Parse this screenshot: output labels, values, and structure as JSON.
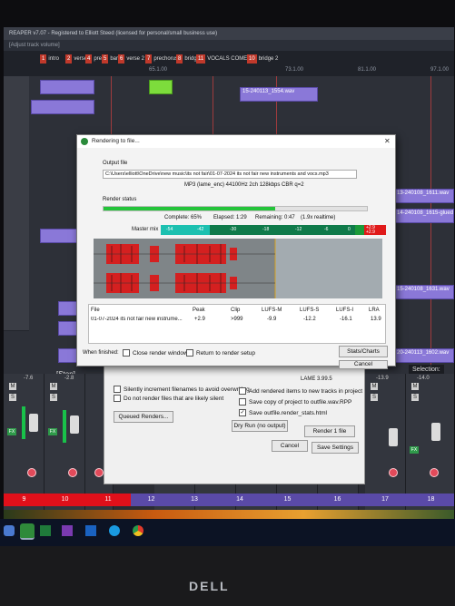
{
  "app": {
    "title_text": "REAPER v7.07 - Registered to Elliott Steed (licensed for personal/small business use)",
    "subtitle": "[Adjust track volume]"
  },
  "markers": [
    {
      "num": "1",
      "label": "intro"
    },
    {
      "num": "2",
      "label": "verse 1"
    },
    {
      "num": "4",
      "label": "pre"
    },
    {
      "num": "5",
      "label": "bar"
    },
    {
      "num": "6",
      "label": "verse 2"
    },
    {
      "num": "7",
      "label": "prechorus"
    },
    {
      "num": "8",
      "label": "bridge"
    },
    {
      "num": "11",
      "label": "VOCALS COME IN"
    },
    {
      "num": "10",
      "label": "bridge 2"
    }
  ],
  "timecodes": [
    "65.1.00",
    "73.1.00",
    "81.1.00",
    "97.1.00"
  ],
  "tracks": {
    "clip_names": [
      "15-240113_1554.wav",
      "13-240108_1611.wav",
      "14-240108_1615-glued",
      "15-240108_1631.wav",
      "20-240113_1602.wav"
    ]
  },
  "render_dialog": {
    "title": "Rendering to file...",
    "output_label": "Output file",
    "output_path": "C:\\Users\\elliott\\OneDrive\\new music\\its not fair\\01-07-2024 its not fair new instruments and vocs.mp3",
    "format_line": "MP3 (lame_enc) 44100Hz 2ch 128kbps CBR q=2",
    "status_label": "Render status",
    "progress_fraction": 0.65,
    "complete_text": "Complete: 65%",
    "elapsed_text": "Elapsed: 1:29",
    "remaining_text": "Remaining: 0:47",
    "speed_text": "(1.9x realtime)",
    "master_mix_label": "Master mix",
    "level_ticks": [
      "-54",
      "-42",
      "-30",
      "-18",
      "-12",
      "-6",
      "0"
    ],
    "peak_readout_1": "+2.9",
    "peak_readout_2": "+2.9",
    "stats_headers": [
      "File",
      "Peak",
      "Clip",
      "LUFS-M",
      "LUFS-S",
      "LUFS-I",
      "LRA"
    ],
    "stats_row": [
      "01-07-2024 its not fair new instrume...",
      "+2.9",
      ">999",
      "-9.9",
      "-12.2",
      "-16.1",
      "13.9"
    ],
    "when_finished_label": "When finished:",
    "close_render_windows": "Close render windows",
    "return_to_render_setup": "Return to render setup",
    "stats_button": "Stats/Charts",
    "cancel_button": "Cancel"
  },
  "render_settings": {
    "lame_version": "LAME 3.99.5",
    "silently_increment": "Silently increment filenames to avoid overwriting",
    "do_not_render_silent": "Do not render files that are likely silent",
    "add_rendered_items": "Add rendered items to new tracks in project",
    "save_copy_project": "Save copy of project to outfile.wav.RPP",
    "save_outfile_stats": "Save outfile.render_stats.html",
    "queued_renders": "Queued Renders...",
    "dry_run": "Dry Run (no output)",
    "render_file": "Render 1 file",
    "cancel": "Cancel",
    "save_settings": "Save Settings"
  },
  "background_ui": {
    "stop_label": "[Stop]",
    "selection_label": "Selection:",
    "mixer_db_values": [
      "-7.6",
      "-2.8",
      "-13.9",
      "-14.0"
    ],
    "mixer_numbers": [
      "9",
      "10",
      "11",
      "12",
      "13",
      "14",
      "15",
      "16",
      "17",
      "18"
    ]
  },
  "monitor": {
    "brand": "DELL"
  },
  "colors": {
    "progress_green": "#24c43a",
    "clip_purple": "#8a78d8",
    "waveform_red": "#d42020",
    "marker_red": "#c0392b"
  }
}
